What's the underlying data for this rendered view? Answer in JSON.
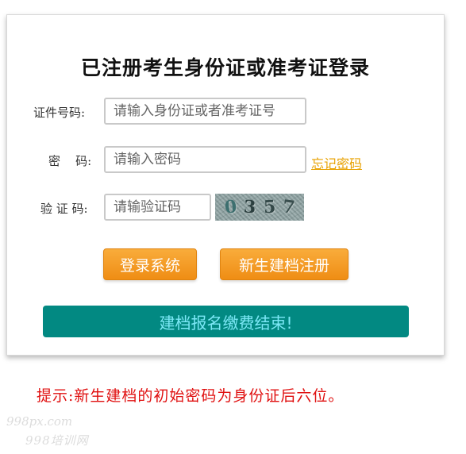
{
  "panel": {
    "title": "已注册考生身份证或准考证登录"
  },
  "form": {
    "id_label": "证件号码:",
    "id_placeholder": "请输入身份证或者准考证号",
    "password_label": "密    码:",
    "password_placeholder": "请输入密码",
    "forgot_link": "忘记密码",
    "captcha_label": "验 证 码:",
    "captcha_placeholder": "请输验证码",
    "captcha_chars": [
      "0",
      "3",
      "5",
      "7"
    ]
  },
  "buttons": {
    "login": "登录系统",
    "register": "新生建档注册",
    "archive_end": "建档报名缴费结束!"
  },
  "hint": "提示:新生建档的初始密码为身份证后六位。",
  "watermark": {
    "line1": "998px.com",
    "line2": "998培训网"
  },
  "colors": {
    "accent_orange": "#ef8d14",
    "banner_teal": "#028982",
    "hint_red": "#e01010",
    "link_orange": "#e8a100"
  }
}
